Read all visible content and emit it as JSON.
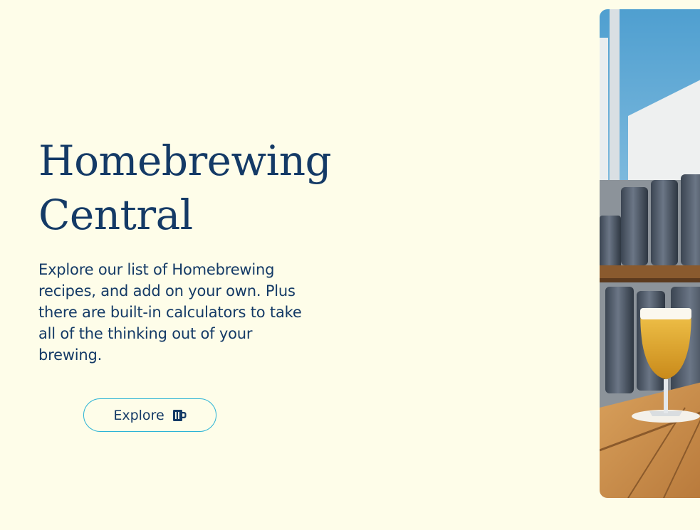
{
  "hero": {
    "title_line1": "Homebrewing",
    "title_line2": "Central",
    "description": "Explore our list of Homebrewing recipes, and add on your own. Plus there are built-in calculators to take all of the thinking out of your brewing.",
    "button_label": "Explore",
    "button_icon": "beer-mug-icon"
  },
  "colors": {
    "background": "#fefde9",
    "text": "#143a66",
    "button_border": "#2ab3d6"
  }
}
